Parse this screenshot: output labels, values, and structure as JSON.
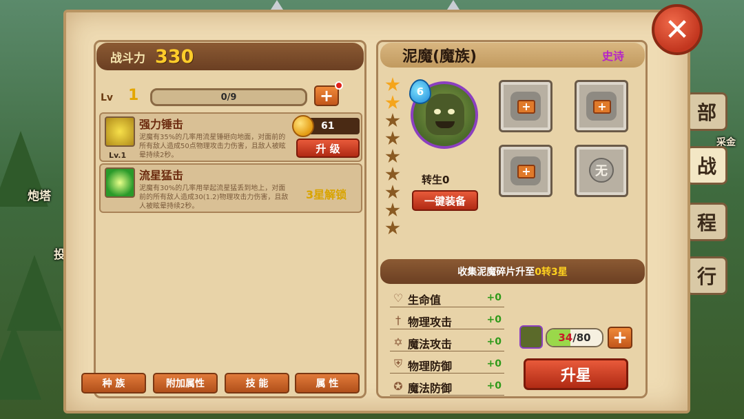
{
  "background": {
    "labels": [
      {
        "text": "炮塔"
      },
      {
        "text": "投"
      },
      {
        "text": "采金"
      }
    ]
  },
  "side_tabs": [
    {
      "label": "部"
    },
    {
      "label": "战"
    },
    {
      "label": "程"
    },
    {
      "label": "行"
    }
  ],
  "left_panel": {
    "power_label": "战斗力",
    "power_value": "330",
    "level_label": "Lv",
    "level_value": "1",
    "exp_text": "0/9",
    "exp_progress": 0,
    "plus_label": "+",
    "skills": [
      {
        "name": "强力锤击",
        "description": "泥魔有35%的几率用流星锤砸向地面，对面前的所有敌人造成50点物理攻击力伤害，且敌人被眩晕持续2秒。",
        "level": "Lv.1",
        "cost": "61",
        "button_label": "升 级"
      },
      {
        "name": "流星猛击",
        "description": "泥魔有30%的几率用举起流星猛丢到地上，对面前的所有敌人造成30(1.2)物理攻击力伤害，且敌人被眩晕持续2秒。",
        "unlock_text": "3星解锁"
      }
    ],
    "bottom_tabs": [
      {
        "label": "种 族"
      },
      {
        "label": "附加属性"
      },
      {
        "label": "技 能"
      },
      {
        "label": "属 性"
      }
    ]
  },
  "right_panel": {
    "hero_name": "泥魔(魔族)",
    "grade": "史诗",
    "star_count_total": 9,
    "stars_lit": 2,
    "portrait_badge": "6",
    "rebirth_label": "转生0",
    "equip_all_label": "一键装备",
    "equip_slots": [
      {
        "type": "plus",
        "label": "+"
      },
      {
        "type": "plus",
        "label": "+"
      },
      {
        "type": "plus",
        "label": "+"
      },
      {
        "type": "none",
        "label": "无"
      }
    ],
    "collect_prefix": "收集泥魔碎片升至",
    "collect_target": "0转3星",
    "stats": [
      {
        "icon": "heart-icon",
        "glyph": "♡",
        "label": "生命值",
        "value": "+0"
      },
      {
        "icon": "sword-icon",
        "glyph": "†",
        "label": "物理攻击",
        "value": "+0"
      },
      {
        "icon": "hexagram-icon",
        "glyph": "✡",
        "label": "魔法攻击",
        "value": "+0"
      },
      {
        "icon": "shield-icon",
        "glyph": "⛨",
        "label": "物理防御",
        "value": "+0"
      },
      {
        "icon": "magic-shield-icon",
        "glyph": "✪",
        "label": "魔法防御",
        "value": "+0"
      }
    ],
    "fragments_current": "34",
    "fragments_total": "/80",
    "fragments_progress": 0.425,
    "fragment_plus_label": "+",
    "star_up_label": "升星"
  },
  "close_label": "✕",
  "colors": {
    "accent_orange": "#e07a2a",
    "epic_purple": "#b624c8",
    "power_gold": "#ffcc2a",
    "stat_green": "#2f9a1a"
  }
}
